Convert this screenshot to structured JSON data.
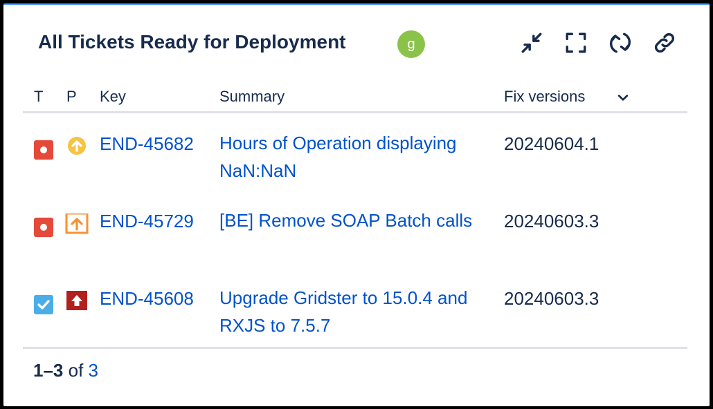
{
  "gadget": {
    "title": "All Tickets Ready for Deployment",
    "avatar_letter": "g",
    "tools": [
      "minimize-icon",
      "fullscreen-icon",
      "refresh-icon",
      "link-icon"
    ]
  },
  "table": {
    "headers": {
      "type": "T",
      "priority": "P",
      "key": "Key",
      "summary": "Summary",
      "fix_versions": "Fix versions"
    },
    "rows": [
      {
        "type": "bug",
        "priority": "major",
        "key": "END-45682",
        "summary": "Hours of Operation displaying NaN:NaN",
        "fix_version": "20240604.1"
      },
      {
        "type": "bug",
        "priority": "high",
        "key": "END-45729",
        "summary": "[BE] Remove SOAP Batch calls",
        "fix_version": "20240603.3"
      },
      {
        "type": "task",
        "priority": "highest",
        "key": "END-45608",
        "summary": "Upgrade Gridster to 15.0.4 and RXJS to 7.5.7",
        "fix_version": "20240603.3"
      }
    ]
  },
  "pager": {
    "range": "1–3",
    "of_label": "of",
    "total": "3"
  },
  "colors": {
    "link": "#0052cc",
    "text": "#172b4d",
    "bug": "#e5493a",
    "task": "#4bade8",
    "avatar": "#8bc34a"
  }
}
